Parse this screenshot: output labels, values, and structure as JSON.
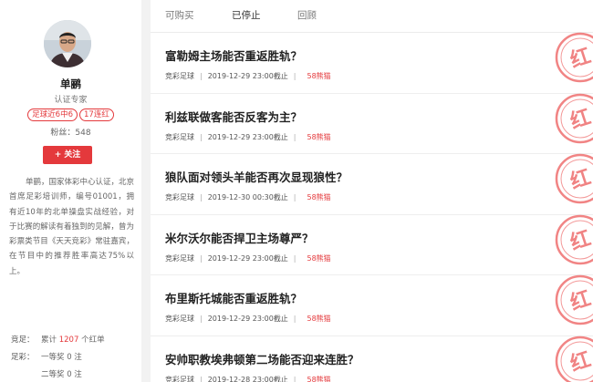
{
  "profile": {
    "name": "单鹂",
    "certification": "认证专家",
    "tags": [
      "足球近6中6",
      "17连红"
    ],
    "fans": "粉丝：548",
    "follow_label": "关注",
    "bio": "单鹂，国家体彩中心认证，北京首席足彩培训师，编号01001，拥有近10年的北单操盘实战经验，对于比赛的解读有着独到的见解，曾为彩票类节目《天天竞彩》常驻嘉宾，在节目中的推荐胜率高达75%以上。",
    "stats": {
      "competitive_label": "竞足：",
      "competitive_prefix": "累计",
      "competitive_count": "1207",
      "competitive_suffix": "个红单",
      "lottery_label": "足彩：",
      "first_prize": "一等奖 0 注",
      "second_prize": "二等奖 0 注"
    }
  },
  "tabs": [
    "可购买",
    "已停止",
    "回顾"
  ],
  "active_tab": "已停止",
  "articles": [
    {
      "title": "富勒姆主场能否重返胜轨？",
      "category": "竞彩足球",
      "time": "2019-12-29 23:00截止",
      "price": "58熊猫"
    },
    {
      "title": "利兹联做客能否反客为主？",
      "category": "竞彩足球",
      "time": "2019-12-29 23:00截止",
      "price": "58熊猫"
    },
    {
      "title": "狼队面对领头羊能否再次显现狼性？",
      "category": "竞彩足球",
      "time": "2019-12-30 00:30截止",
      "price": "58熊猫"
    },
    {
      "title": "米尔沃尔能否捍卫主场尊严？",
      "category": "竞彩足球",
      "time": "2019-12-29 23:00截止",
      "price": "58熊猫"
    },
    {
      "title": "布里斯托城能否重返胜轨？",
      "category": "竞彩足球",
      "time": "2019-12-29 23:00截止",
      "price": "58熊猫"
    },
    {
      "title": "安帅职教埃弗顿第二场能否迎来连胜？",
      "category": "竞彩足球",
      "time": "2019-12-28 23:00截止",
      "price": "58熊猫"
    }
  ],
  "stamp_text": "红",
  "colors": {
    "accent": "#e4393c",
    "stamp": "#ee6e6e"
  },
  "icons": {
    "avatar": "user-avatar-photo",
    "stamp": "red-win-stamp-icon"
  }
}
